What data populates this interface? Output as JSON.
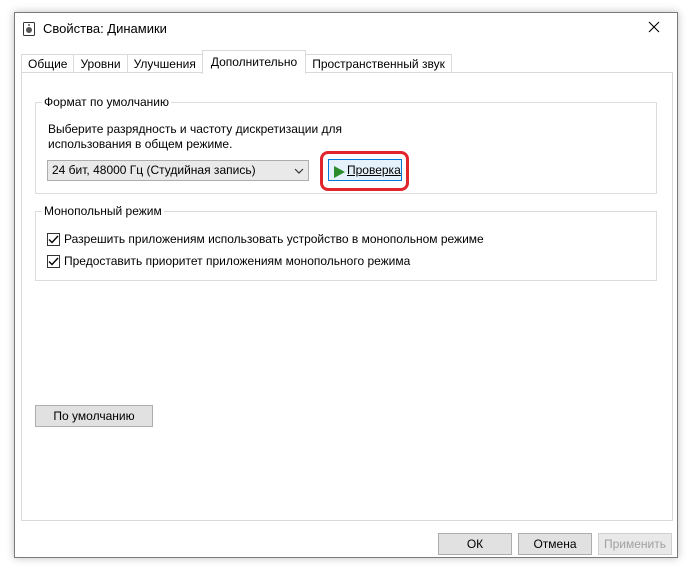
{
  "window": {
    "title": "Свойства: Динамики",
    "close_symbol": "✕"
  },
  "tabs": [
    {
      "label": "Общие",
      "active": false
    },
    {
      "label": "Уровни",
      "active": false
    },
    {
      "label": "Улучшения",
      "active": false
    },
    {
      "label": "Дополнительно",
      "active": true
    },
    {
      "label": "Пространственный звук",
      "active": false
    }
  ],
  "default_format": {
    "legend": "Формат по умолчанию",
    "description": "Выберите разрядность и частоту дискретизации для использования в общем режиме.",
    "selected_format": "24 бит, 48000 Гц (Студийная запись)",
    "test_button": "Проверка"
  },
  "exclusive_mode": {
    "legend": "Монопольный режим",
    "options": [
      {
        "label": "Разрешить приложениям использовать устройство в монопольном режиме",
        "checked": true
      },
      {
        "label": "Предоставить приоритет приложениям монопольного режима",
        "checked": true
      }
    ]
  },
  "restore_defaults_button": "По умолчанию",
  "footer": {
    "ok": "ОК",
    "cancel": "Отмена",
    "apply": "Применить"
  },
  "colors": {
    "highlight": "#e0262c",
    "focus_border": "#0078d7",
    "play_icon": "#2a8c2a"
  }
}
